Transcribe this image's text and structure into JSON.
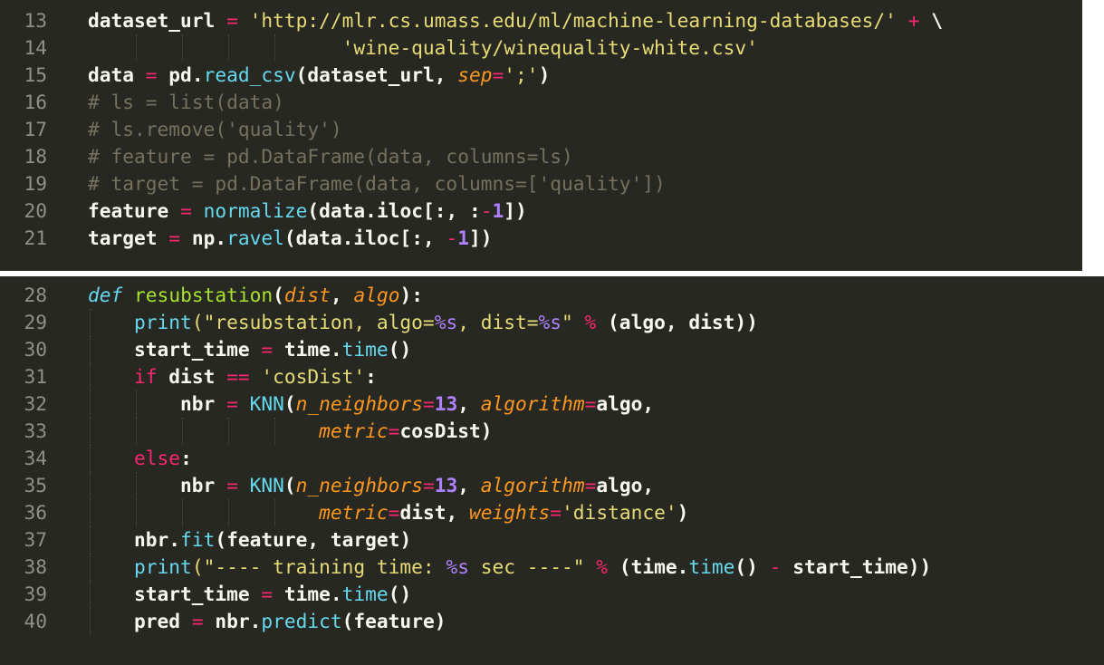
{
  "snippets": [
    {
      "id": "top",
      "lines": [
        {
          "n": "13",
          "guides": 0,
          "tokens": [
            {
              "t": "dataset_url ",
              "c": "plain"
            },
            {
              "t": "=",
              "c": "op"
            },
            {
              "t": " 'http://mlr.cs.umass.edu/ml/machine-learning-databases/' ",
              "c": "str"
            },
            {
              "t": "+",
              "c": "op"
            },
            {
              "t": " \\",
              "c": "plain"
            }
          ]
        },
        {
          "n": "14",
          "guides": 5,
          "tokens": [
            {
              "t": "                      'wine-quality/winequality-white.csv'",
              "c": "str"
            }
          ]
        },
        {
          "n": "15",
          "guides": 0,
          "tokens": [
            {
              "t": "data ",
              "c": "plain"
            },
            {
              "t": "=",
              "c": "op"
            },
            {
              "t": " pd.",
              "c": "plain"
            },
            {
              "t": "read_csv",
              "c": "func"
            },
            {
              "t": "(dataset_url, ",
              "c": "plain"
            },
            {
              "t": "sep",
              "c": "arg"
            },
            {
              "t": "=",
              "c": "op"
            },
            {
              "t": "';'",
              "c": "str"
            },
            {
              "t": ")",
              "c": "plain"
            }
          ]
        },
        {
          "n": "16",
          "guides": 0,
          "tokens": [
            {
              "t": "# ls = list(data)",
              "c": "comment"
            }
          ]
        },
        {
          "n": "17",
          "guides": 0,
          "tokens": [
            {
              "t": "# ls.remove('quality')",
              "c": "comment"
            }
          ]
        },
        {
          "n": "18",
          "guides": 0,
          "tokens": [
            {
              "t": "# feature = pd.DataFrame(data, columns=ls)",
              "c": "comment"
            }
          ]
        },
        {
          "n": "19",
          "guides": 0,
          "tokens": [
            {
              "t": "# target = pd.DataFrame(data, columns=['quality'])",
              "c": "comment"
            }
          ]
        },
        {
          "n": "20",
          "guides": 0,
          "tokens": [
            {
              "t": "feature ",
              "c": "plain"
            },
            {
              "t": "=",
              "c": "op"
            },
            {
              "t": " ",
              "c": "plain"
            },
            {
              "t": "normalize",
              "c": "func"
            },
            {
              "t": "(data.iloc[:, :",
              "c": "plain"
            },
            {
              "t": "-",
              "c": "op"
            },
            {
              "t": "1",
              "c": "num"
            },
            {
              "t": "])",
              "c": "plain"
            }
          ]
        },
        {
          "n": "21",
          "guides": 0,
          "tokens": [
            {
              "t": "target ",
              "c": "plain"
            },
            {
              "t": "=",
              "c": "op"
            },
            {
              "t": " np.",
              "c": "plain"
            },
            {
              "t": "ravel",
              "c": "func"
            },
            {
              "t": "(data.iloc[:, ",
              "c": "plain"
            },
            {
              "t": "-",
              "c": "op"
            },
            {
              "t": "1",
              "c": "num"
            },
            {
              "t": "])",
              "c": "plain"
            }
          ]
        }
      ]
    },
    {
      "id": "bottom",
      "lines": [
        {
          "n": "28",
          "guides": 0,
          "tokens": [
            {
              "t": "def",
              "c": "def"
            },
            {
              "t": " ",
              "c": "plain"
            },
            {
              "t": "resubstation",
              "c": "fname"
            },
            {
              "t": "(",
              "c": "plain"
            },
            {
              "t": "dist",
              "c": "arg"
            },
            {
              "t": ", ",
              "c": "plain"
            },
            {
              "t": "algo",
              "c": "arg"
            },
            {
              "t": "):",
              "c": "plain"
            }
          ]
        },
        {
          "n": "29",
          "guides": 1,
          "tokens": [
            {
              "t": "    ",
              "c": "plain"
            },
            {
              "t": "print",
              "c": "builtin"
            },
            {
              "t": "(\"resubstation, algo=",
              "c": "str"
            },
            {
              "t": "%s",
              "c": "fmt"
            },
            {
              "t": ", dist=",
              "c": "str"
            },
            {
              "t": "%s",
              "c": "fmt"
            },
            {
              "t": "\" ",
              "c": "str"
            },
            {
              "t": "%",
              "c": "op"
            },
            {
              "t": " (algo, dist))",
              "c": "plain"
            }
          ]
        },
        {
          "n": "30",
          "guides": 1,
          "tokens": [
            {
              "t": "    start_time ",
              "c": "plain"
            },
            {
              "t": "=",
              "c": "op"
            },
            {
              "t": " time.",
              "c": "plain"
            },
            {
              "t": "time",
              "c": "func"
            },
            {
              "t": "()",
              "c": "plain"
            }
          ]
        },
        {
          "n": "31",
          "guides": 1,
          "tokens": [
            {
              "t": "    ",
              "c": "plain"
            },
            {
              "t": "if",
              "c": "kw"
            },
            {
              "t": " dist ",
              "c": "plain"
            },
            {
              "t": "==",
              "c": "op"
            },
            {
              "t": " 'cosDist'",
              "c": "str"
            },
            {
              "t": ":",
              "c": "plain"
            }
          ]
        },
        {
          "n": "32",
          "guides": 2,
          "tokens": [
            {
              "t": "        nbr ",
              "c": "plain"
            },
            {
              "t": "=",
              "c": "op"
            },
            {
              "t": " ",
              "c": "plain"
            },
            {
              "t": "KNN",
              "c": "func"
            },
            {
              "t": "(",
              "c": "plain"
            },
            {
              "t": "n_neighbors",
              "c": "arg"
            },
            {
              "t": "=",
              "c": "op"
            },
            {
              "t": "13",
              "c": "num"
            },
            {
              "t": ", ",
              "c": "plain"
            },
            {
              "t": "algorithm",
              "c": "arg"
            },
            {
              "t": "=",
              "c": "op"
            },
            {
              "t": "algo,",
              "c": "plain"
            }
          ]
        },
        {
          "n": "33",
          "guides": 5,
          "tokens": [
            {
              "t": "                    ",
              "c": "plain"
            },
            {
              "t": "metric",
              "c": "arg"
            },
            {
              "t": "=",
              "c": "op"
            },
            {
              "t": "cosDist)",
              "c": "plain"
            }
          ]
        },
        {
          "n": "34",
          "guides": 1,
          "tokens": [
            {
              "t": "    ",
              "c": "plain"
            },
            {
              "t": "else",
              "c": "kw"
            },
            {
              "t": ":",
              "c": "plain"
            }
          ]
        },
        {
          "n": "35",
          "guides": 2,
          "tokens": [
            {
              "t": "        nbr ",
              "c": "plain"
            },
            {
              "t": "=",
              "c": "op"
            },
            {
              "t": " ",
              "c": "plain"
            },
            {
              "t": "KNN",
              "c": "func"
            },
            {
              "t": "(",
              "c": "plain"
            },
            {
              "t": "n_neighbors",
              "c": "arg"
            },
            {
              "t": "=",
              "c": "op"
            },
            {
              "t": "13",
              "c": "num"
            },
            {
              "t": ", ",
              "c": "plain"
            },
            {
              "t": "algorithm",
              "c": "arg"
            },
            {
              "t": "=",
              "c": "op"
            },
            {
              "t": "algo,",
              "c": "plain"
            }
          ]
        },
        {
          "n": "36",
          "guides": 5,
          "tokens": [
            {
              "t": "                    ",
              "c": "plain"
            },
            {
              "t": "metric",
              "c": "arg"
            },
            {
              "t": "=",
              "c": "op"
            },
            {
              "t": "dist, ",
              "c": "plain"
            },
            {
              "t": "weights",
              "c": "arg"
            },
            {
              "t": "=",
              "c": "op"
            },
            {
              "t": "'distance'",
              "c": "str"
            },
            {
              "t": ")",
              "c": "plain"
            }
          ]
        },
        {
          "n": "37",
          "guides": 1,
          "tokens": [
            {
              "t": "    nbr.",
              "c": "plain"
            },
            {
              "t": "fit",
              "c": "func"
            },
            {
              "t": "(feature, target)",
              "c": "plain"
            }
          ]
        },
        {
          "n": "38",
          "guides": 1,
          "tokens": [
            {
              "t": "    ",
              "c": "plain"
            },
            {
              "t": "print",
              "c": "builtin"
            },
            {
              "t": "(\"---- training time: ",
              "c": "str"
            },
            {
              "t": "%s",
              "c": "fmt"
            },
            {
              "t": " sec ----\" ",
              "c": "str"
            },
            {
              "t": "%",
              "c": "op"
            },
            {
              "t": " (time.",
              "c": "plain"
            },
            {
              "t": "time",
              "c": "func"
            },
            {
              "t": "() ",
              "c": "plain"
            },
            {
              "t": "-",
              "c": "op"
            },
            {
              "t": " start_time))",
              "c": "plain"
            }
          ]
        },
        {
          "n": "39",
          "guides": 1,
          "tokens": [
            {
              "t": "    start_time ",
              "c": "plain"
            },
            {
              "t": "=",
              "c": "op"
            },
            {
              "t": " time.",
              "c": "plain"
            },
            {
              "t": "time",
              "c": "func"
            },
            {
              "t": "()",
              "c": "plain"
            }
          ]
        },
        {
          "n": "40",
          "guides": 1,
          "tokens": [
            {
              "t": "    pred ",
              "c": "plain"
            },
            {
              "t": "=",
              "c": "op"
            },
            {
              "t": " nbr.",
              "c": "plain"
            },
            {
              "t": "predict",
              "c": "func"
            },
            {
              "t": "(feature)",
              "c": "plain"
            }
          ]
        }
      ]
    }
  ],
  "colors": {
    "background": "#272822",
    "plain": "#f8f8f2",
    "keyword": "#f92672",
    "string": "#e6db74",
    "function": "#66d9ef",
    "argument": "#fd971f",
    "number": "#ae81ff",
    "comment": "#75715e",
    "def_name": "#a6e22e",
    "line_number": "#8f908a"
  }
}
